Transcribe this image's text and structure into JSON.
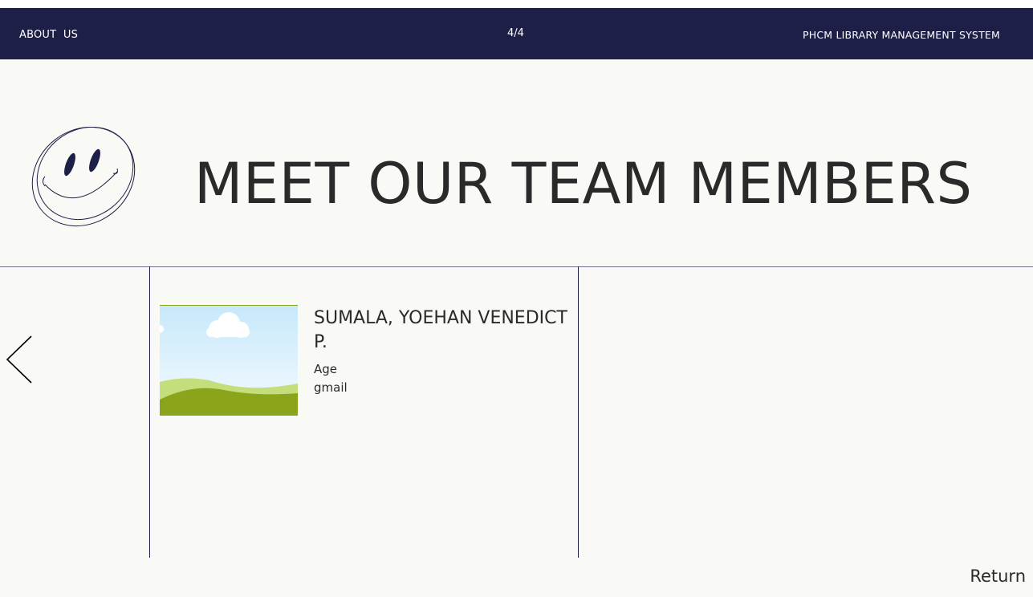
{
  "header": {
    "left_label": "ABOUT  US",
    "page_indicator": "4/4",
    "right_label": "PHCM LIBRARY MANAGEMENT SYSTEM"
  },
  "title": "MEET OUR TEAM MEMBERS",
  "member": {
    "name": "SUMALA, YOEHAN VENEDICT P.",
    "age_label": "Age",
    "email_label": "gmail",
    "photo_icon": "landscape-placeholder-icon"
  },
  "nav": {
    "prev_icon": "chevron-left-icon"
  },
  "footer": {
    "return_label": "Return"
  },
  "colors": {
    "header_bg": "#1e1f47",
    "page_bg": "#f9faf5",
    "text": "#2a2a2a",
    "accent": "#1e1f47"
  }
}
